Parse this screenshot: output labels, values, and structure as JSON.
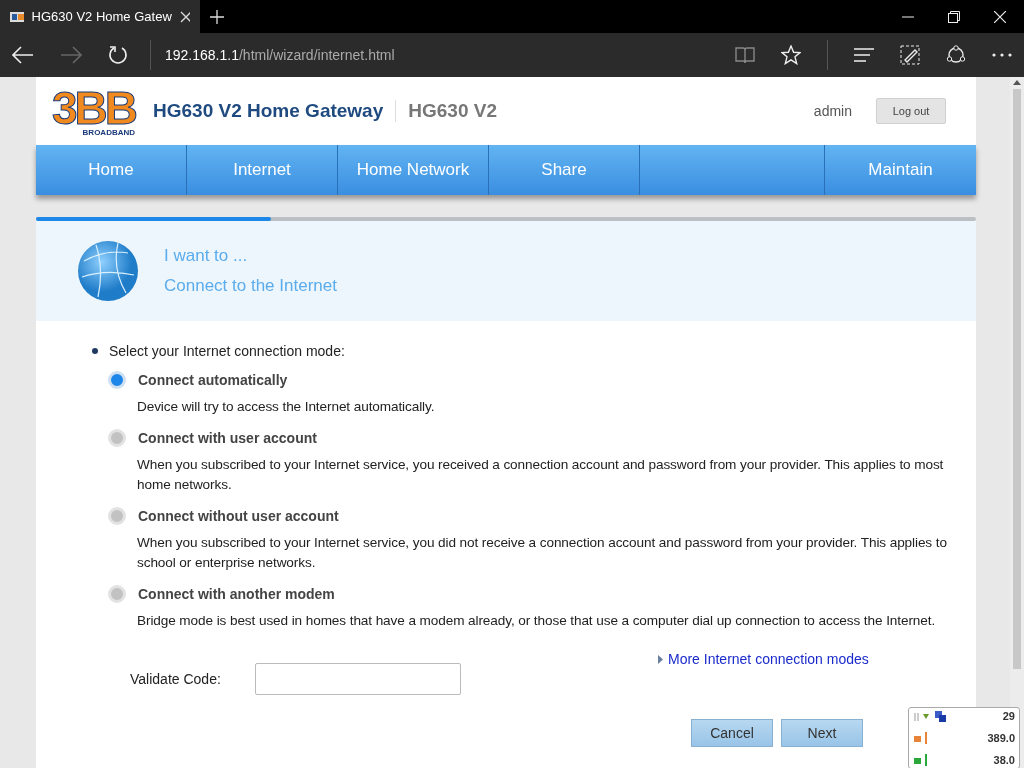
{
  "browser": {
    "tab_title": "HG630 V2 Home Gatew",
    "url_host": "192.168.1.1",
    "url_path": "/html/wizard/internet.html"
  },
  "header": {
    "logo_mark": "3BB",
    "logo_sub": "BROADBAND",
    "title": "HG630 V2 Home Gateway",
    "model": "HG630 V2",
    "user": "admin",
    "logout": "Log out"
  },
  "nav": [
    {
      "label": "Home",
      "selected": false
    },
    {
      "label": "Internet",
      "selected": false
    },
    {
      "label": "Home Network",
      "selected": false
    },
    {
      "label": "Share",
      "selected": false
    },
    {
      "label": "Maintain",
      "selected": false
    }
  ],
  "wizard": {
    "level": 0.25,
    "heading": "I want to ...",
    "subheading": "Connect to the Internet"
  },
  "prompt": "Select your Internet connection mode:",
  "modes": [
    {
      "title": "Connect automatically",
      "description": "Device will try to access the Internet automatically.",
      "selected": true
    },
    {
      "title": "Connect with user account",
      "description": "When you subscribed to your Internet service, you received a connection account and password from your provider. This applies to most home networks.",
      "selected": false
    },
    {
      "title": "Connect without user account",
      "description": "When you subscribed to your Internet service, you did not receive a connection account and password from your provider. This applies to school or enterprise networks.",
      "selected": false
    },
    {
      "title": "Connect with another modem",
      "description": "Bridge mode is best used in homes that have a modem already, or those that use a computer dial up connection to access the Internet.",
      "selected": false
    }
  ],
  "more_link": "More Internet connection modes",
  "validate": {
    "label": "Validate Code:"
  },
  "buttons": [
    "Cancel",
    "Next"
  ],
  "tray_widget": {
    "count": "29",
    "upload": "389.0",
    "download": "38.0"
  }
}
